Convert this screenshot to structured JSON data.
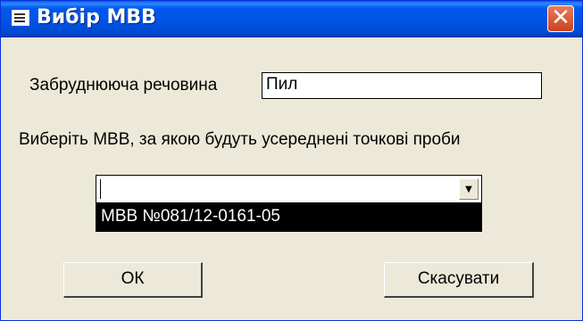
{
  "window": {
    "title": "Вибір МВВ",
    "close_glyph": "✕"
  },
  "form": {
    "pollutant_label": "Забруднююча речовина",
    "pollutant_value": "Пил",
    "instruction": "Виберіть МВВ, за якою будуть усереднені точкові проби",
    "combo_value": "",
    "combo_arrow_glyph": "▼",
    "dropdown_items": [
      "МВВ №081/12-0161-05"
    ]
  },
  "buttons": {
    "ok": "ОК",
    "cancel": "Скасувати"
  }
}
